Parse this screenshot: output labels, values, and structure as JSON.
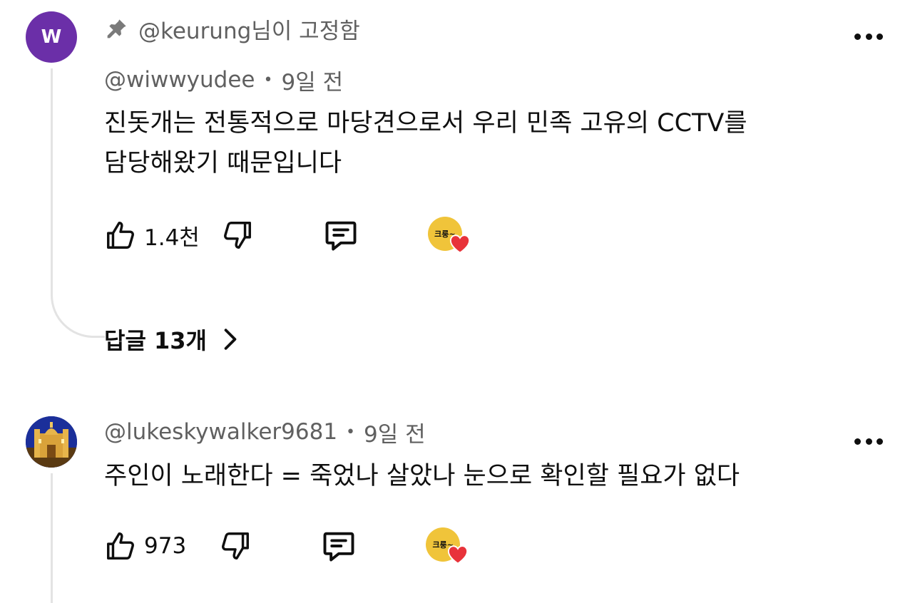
{
  "comments": [
    {
      "avatar_letter": "W",
      "pinned_label": "@keurung님이 고정함",
      "author": "@wiwwyudee",
      "time": "9일 전",
      "text_lines": [
        "진돗개는 전통적으로 마당견으로서 우리 민족 고유의 CCTV를",
        "담당해왔기 때문입니다"
      ],
      "likes": "1.4천",
      "creator_badge_text": "크룽~",
      "replies_label": "답글 13개"
    },
    {
      "author": "@lukeskywalker9681",
      "time": "9일 전",
      "text_lines": [
        "주인이 노래한다 = 죽었나 살았나 눈으로 확인할 필요가 없다"
      ],
      "likes": "973",
      "creator_badge_text": "크룽~"
    }
  ],
  "icons": {
    "pin": "pin-icon",
    "more": "more-vertical-icon",
    "like": "thumbs-up-icon",
    "dislike": "thumbs-down-icon",
    "reply": "comment-icon",
    "heart": "heart-icon",
    "chevron": "chevron-right-icon"
  },
  "colors": {
    "avatar_purple": "#6b2fa8",
    "secondary_text": "#606060",
    "heart_red": "#e8333a",
    "badge_yellow": "#f0c43a"
  }
}
